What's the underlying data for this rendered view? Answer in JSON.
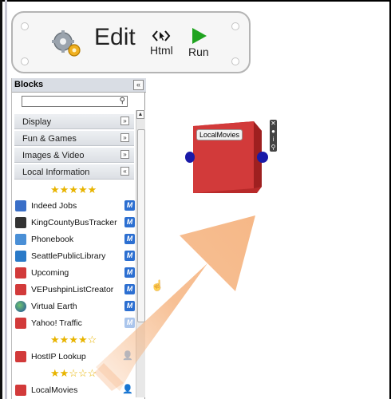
{
  "toolbar": {
    "edit_label": "Edit",
    "html_label": "Html",
    "run_label": "Run"
  },
  "panel": {
    "title": "Blocks",
    "collapse_glyph": "«",
    "search_placeholder": "",
    "categories": [
      {
        "label": "Display",
        "chevron": "»",
        "expanded": false
      },
      {
        "label": "Fun & Games",
        "chevron": "»",
        "expanded": false
      },
      {
        "label": "Images & Video",
        "chevron": "»",
        "expanded": false
      },
      {
        "label": "Local Information",
        "chevron": "«",
        "expanded": true
      }
    ],
    "rating_groups": [
      {
        "stars": "★★★★★",
        "rating": 5
      },
      {
        "stars": "★★★★☆",
        "rating": 4
      },
      {
        "stars": "★★☆☆☆",
        "rating": 2
      }
    ],
    "items": [
      {
        "label": "Indeed Jobs",
        "icon": "indeed-icon",
        "badge": "M"
      },
      {
        "label": "KingCountyBusTracker",
        "icon": "bus-icon",
        "badge": "M"
      },
      {
        "label": "Phonebook",
        "icon": "phonebook-icon",
        "badge": "M"
      },
      {
        "label": "SeattlePublicLibrary",
        "icon": "library-icon",
        "badge": "M"
      },
      {
        "label": "Upcoming",
        "icon": "red-block-icon",
        "badge": "M"
      },
      {
        "label": "VEPushpinListCreator",
        "icon": "red-block-icon",
        "badge": "M"
      },
      {
        "label": "Virtual Earth",
        "icon": "globe-icon",
        "badge": "M"
      },
      {
        "label": "Yahoo! Traffic",
        "icon": "red-block-icon",
        "badge": "M"
      },
      {
        "label": "HostIP Lookup",
        "icon": "red-block-icon",
        "badge": "person"
      },
      {
        "label": "LocalMovies",
        "icon": "red-block-icon",
        "badge": "person"
      }
    ]
  },
  "canvas": {
    "block_title": "LocalMovies",
    "block_color": "#d23a3a",
    "port_color": "#1a1aa8",
    "side_icons": [
      "close-icon",
      "info-icon",
      "info-icon",
      "search-icon"
    ]
  },
  "colors": {
    "accent_run": "#1fa31f",
    "badge_blue": "#2c6fd1",
    "arrow": "#f5b07a"
  }
}
